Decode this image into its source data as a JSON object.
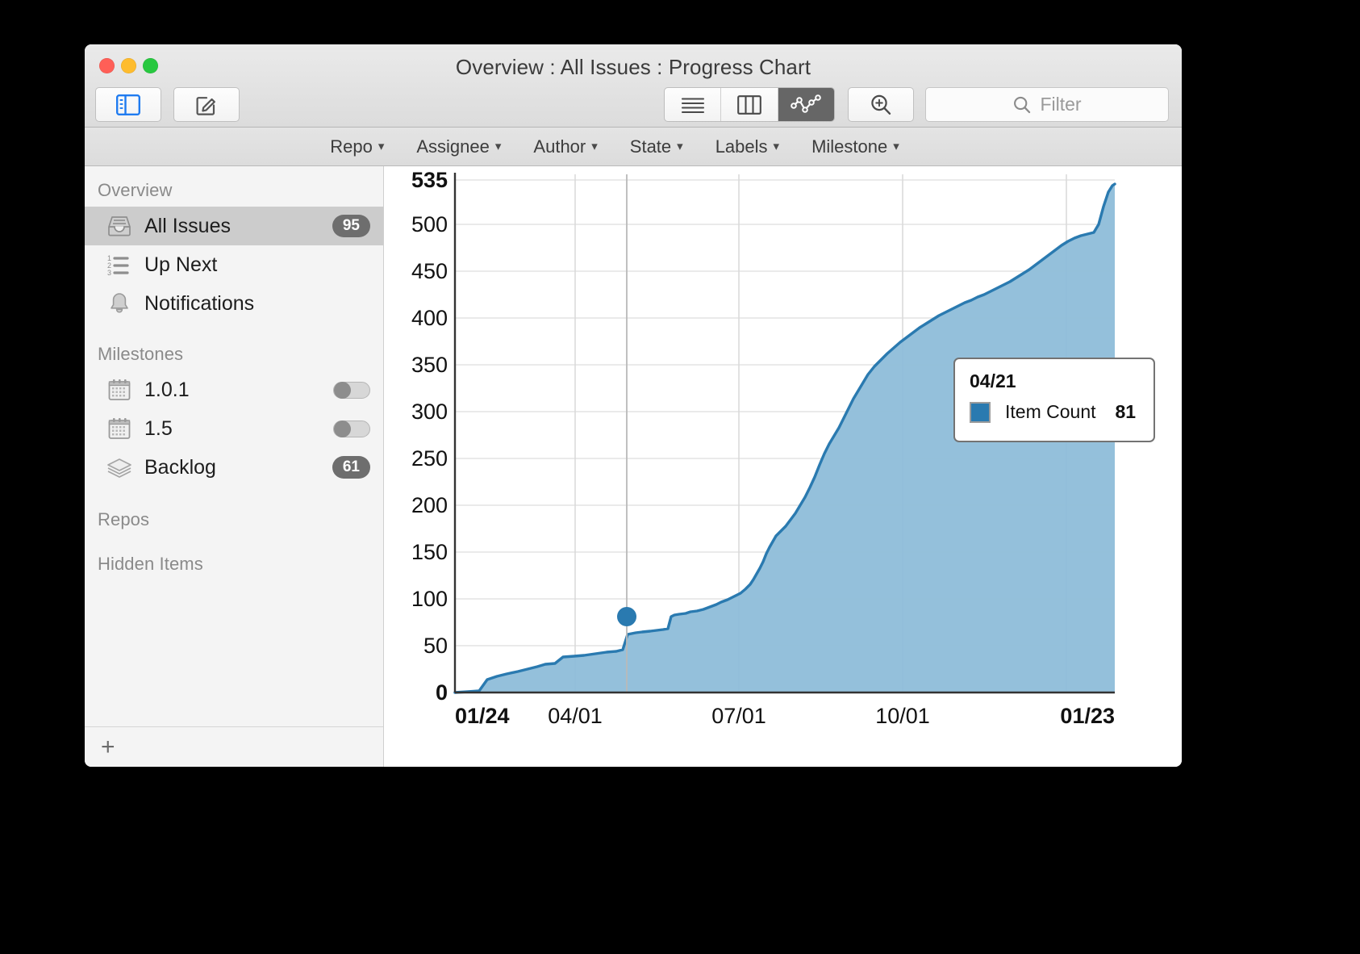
{
  "window": {
    "title": "Overview : All Issues : Progress Chart",
    "traffic_lights": [
      "close",
      "minimize",
      "zoom"
    ]
  },
  "toolbar": {
    "sidebar_toggle": "sidebar-toggle",
    "compose": "compose",
    "view_modes": [
      {
        "name": "list-view",
        "active": false
      },
      {
        "name": "column-view",
        "active": false
      },
      {
        "name": "chart-view",
        "active": true
      }
    ],
    "zoom_button": "zoom-in",
    "filter_placeholder": "Filter",
    "filter_value": ""
  },
  "filter_bar": {
    "items": [
      {
        "label": "Repo"
      },
      {
        "label": "Assignee"
      },
      {
        "label": "Author"
      },
      {
        "label": "State"
      },
      {
        "label": "Labels"
      },
      {
        "label": "Milestone"
      }
    ],
    "caret": "⌄"
  },
  "sidebar": {
    "sections": [
      {
        "header": "Overview",
        "items": [
          {
            "label": "All Issues",
            "icon": "inbox-tray-icon",
            "badge": "95",
            "selected": true,
            "toggle": false
          },
          {
            "label": "Up Next",
            "icon": "numbered-list-icon",
            "badge": null,
            "selected": false,
            "toggle": false
          },
          {
            "label": "Notifications",
            "icon": "bell-icon",
            "badge": null,
            "selected": false,
            "toggle": false
          }
        ]
      },
      {
        "header": "Milestones",
        "items": [
          {
            "label": "1.0.1",
            "icon": "calendar-icon",
            "badge": null,
            "selected": false,
            "toggle": true
          },
          {
            "label": "1.5",
            "icon": "calendar-icon",
            "badge": null,
            "selected": false,
            "toggle": true
          },
          {
            "label": "Backlog",
            "icon": "layers-icon",
            "badge": "61",
            "selected": false,
            "toggle": false
          }
        ]
      },
      {
        "header": "Repos",
        "items": []
      },
      {
        "header": "Hidden Items",
        "items": []
      }
    ],
    "add_button": "+"
  },
  "tooltip": {
    "date": "04/21",
    "series_name": "Item Count",
    "value": "81",
    "swatch_color": "#2a7ab0"
  },
  "colors": {
    "line": "#2a7ab0",
    "fill": "#8ebdd9",
    "accent": "#1f7bf0",
    "badge": "#6e6e6e",
    "grid": "#e2e2e2"
  },
  "chart_data": {
    "type": "area",
    "title": "Progress Chart",
    "xlabel": "",
    "ylabel": "",
    "grid": true,
    "legend_position": "tooltip",
    "series": [
      {
        "name": "Item Count",
        "color": "#2a7ab0",
        "fill": "#8ebdd9",
        "x": [
          "01/24",
          "02/01",
          "02/10",
          "02/20",
          "03/01",
          "03/10",
          "03/20",
          "04/01",
          "04/10",
          "04/21",
          "05/01",
          "05/10",
          "05/20",
          "06/01",
          "06/10",
          "06/20",
          "07/01",
          "07/10",
          "07/20",
          "08/01",
          "08/10",
          "08/20",
          "09/01",
          "09/10",
          "09/20",
          "10/01",
          "10/10",
          "10/20",
          "11/01",
          "11/10",
          "11/20",
          "12/01",
          "12/10",
          "12/20",
          "01/10",
          "01/23"
        ],
        "values": [
          0,
          2,
          10,
          14,
          17,
          20,
          22,
          24,
          33,
          81,
          90,
          95,
          100,
          108,
          110,
          112,
          115,
          155,
          170,
          185,
          200,
          215,
          240,
          265,
          300,
          330,
          355,
          375,
          395,
          405,
          420,
          440,
          460,
          480,
          495,
          535
        ]
      }
    ],
    "y_ticks": [
      0,
      50,
      100,
      150,
      200,
      250,
      300,
      350,
      400,
      450,
      500,
      535
    ],
    "y_tick_labels": [
      "0",
      "50",
      "100",
      "150",
      "200",
      "250",
      "300",
      "350",
      "400",
      "450",
      "500",
      "535"
    ],
    "ylim": [
      0,
      535
    ],
    "x_ticks": [
      "01/24",
      "04/01",
      "07/01",
      "10/01",
      "01/23"
    ],
    "x_tick_labels": [
      "01/24",
      "04/01",
      "07/01",
      "10/01",
      "01/23"
    ],
    "highlight_point": {
      "x": "04/21",
      "y": 81,
      "label": "81"
    },
    "bold_ticks": {
      "y": "535",
      "x_first": "01/24",
      "x_last": "01/23"
    }
  }
}
